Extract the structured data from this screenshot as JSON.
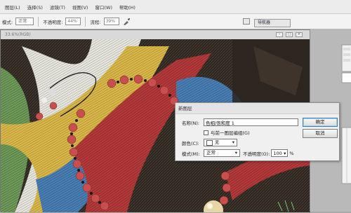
{
  "menu": [
    "图层(L)",
    "选择(S)",
    "滤镜(T)",
    "视图(V)",
    "窗口(W)",
    "帮助(H)"
  ],
  "options": {
    "mode_label": "模式:",
    "mode_value": "正常",
    "opacity_label": "不透明度:",
    "opacity_value": "44%",
    "flow_label": "流程:",
    "flow_value": "39%"
  },
  "panel": {
    "navigator_tab": "导航器"
  },
  "document": {
    "title": "33.6%(RGB)"
  },
  "dialog": {
    "title": "新图层",
    "name_label": "名称(N):",
    "name_value": "色相/饱和度 1",
    "clip_label": "与前一图层编组(G)",
    "color_label": "颜色(C):",
    "color_value": "无",
    "mode_label": "模式(M):",
    "mode_value": "正常",
    "opacity_label": "不透明度(O):",
    "opacity_value": "100",
    "opacity_unit": "%",
    "ok_label": "确定",
    "cancel_label": "取消"
  },
  "colors": {
    "dialog_bg": "#f0f0f0",
    "accent": "#3c7fb1",
    "bead": "#c94f4f",
    "thread_red": "#b33a3a",
    "thread_yellow": "#d8b84a",
    "thread_blue": "#4a7fb5",
    "thread_white": "#e6e6de"
  }
}
